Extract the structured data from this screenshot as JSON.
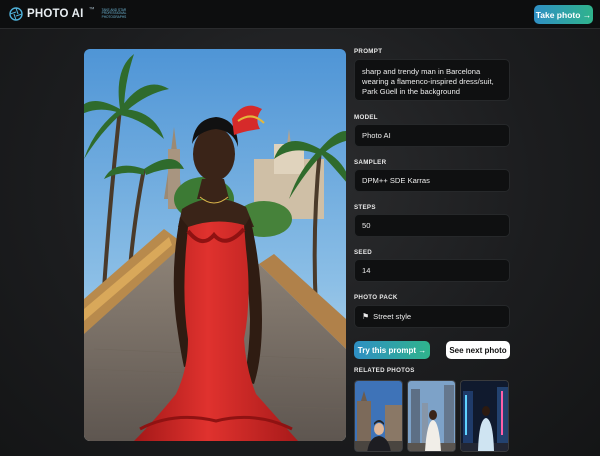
{
  "header": {
    "logo_text": "PHOTO AI",
    "logo_sup": "™",
    "logo_tagline": "Take and star professional photographs",
    "take_photo_label": "Take photo →"
  },
  "photo": {
    "alt": "Woman in a red flamenco-inspired dress in Park Güell"
  },
  "form": {
    "prompt_label": "PROMPT",
    "prompt_value": "sharp and trendy man in Barcelona wearing a flamenco-inspired dress/suit, Park Güell in the background",
    "model_label": "MODEL",
    "model_value": "Photo AI",
    "sampler_label": "SAMPLER",
    "sampler_value": "DPM++ SDE Karras",
    "steps_label": "STEPS",
    "steps_value": "50",
    "seed_label": "SEED",
    "seed_value": "14",
    "pack_label": "PHOTO PACK",
    "pack_value": "Street style",
    "pack_icon": "signpost-icon"
  },
  "actions": {
    "try_label": "Try this prompt →",
    "next_label": "See next photo"
  },
  "related": {
    "label": "RELATED PHOTOS",
    "items": [
      {
        "alt": "Man in suit in front of old city buildings"
      },
      {
        "alt": "Woman in white dress in front of skyscrapers"
      },
      {
        "alt": "Woman in futuristic outfit in neon city"
      }
    ]
  },
  "colors": {
    "accent_start": "#2f8fc4",
    "accent_end": "#2fb38c",
    "background": "#1c1d1f",
    "dress_red": "#d62a2a"
  }
}
